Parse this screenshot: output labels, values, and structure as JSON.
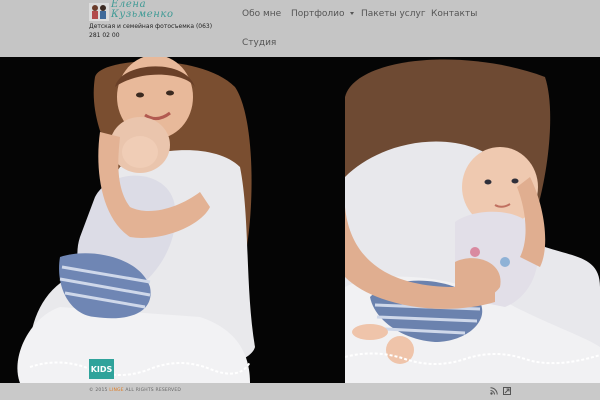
{
  "header": {
    "logo": {
      "line1": "Елена",
      "line2": "Кузьменко"
    },
    "tagline": "Детская и семейная фотосъемка (063) 281 02 00"
  },
  "nav": {
    "items": [
      {
        "label": "Обо мне",
        "has_dropdown": false
      },
      {
        "label": "Портфолио",
        "has_dropdown": true
      },
      {
        "label": "Пакеты услуг",
        "has_dropdown": false
      },
      {
        "label": "Контакты",
        "has_dropdown": false
      },
      {
        "label": "Студия",
        "has_dropdown": false
      }
    ]
  },
  "gallery": {
    "badge": "KIDS"
  },
  "footer": {
    "year_prefix": "© 2015",
    "brand": "LINGE",
    "rights": "ALL RIGHTS RESERVED",
    "icons": [
      "rss-icon",
      "link-icon"
    ]
  },
  "colors": {
    "header_bg": "#c5c5c5",
    "accent": "#3f9a95",
    "badge_bg": "#2fa39b",
    "footer_brand": "#e07a1f",
    "photo_bg": "#050505"
  }
}
